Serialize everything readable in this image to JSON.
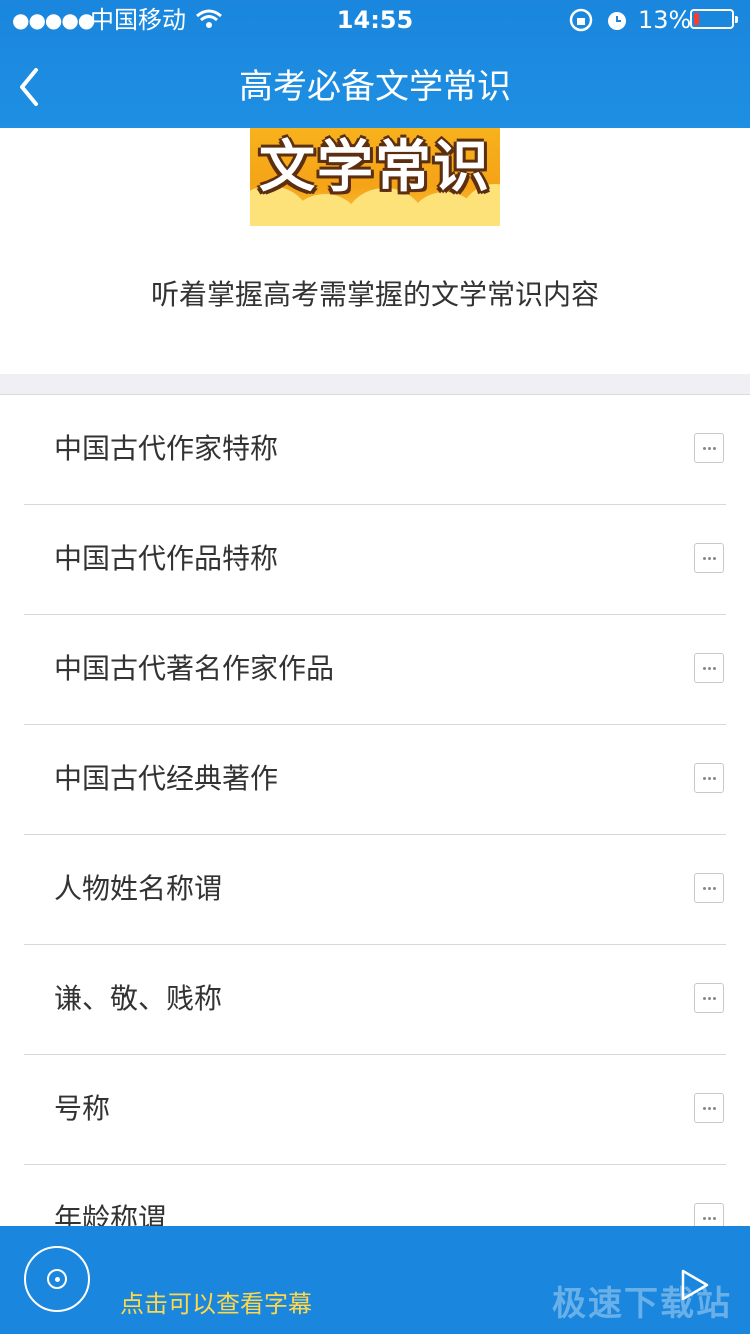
{
  "status_bar": {
    "signal": "●●●●●",
    "carrier": "中国移动",
    "time": "14:55",
    "battery": "13%",
    "battery_level_pct": 13
  },
  "nav": {
    "title": "高考必备文学常识",
    "back_icon": "chevron-left-icon"
  },
  "header": {
    "banner_text": "文学常识",
    "description": "听着掌握高考需掌握的文学常识内容"
  },
  "list": {
    "items": [
      {
        "label": "中国古代作家特称"
      },
      {
        "label": "中国古代作品特称"
      },
      {
        "label": "中国古代著名作家作品"
      },
      {
        "label": "中国古代经典著作"
      },
      {
        "label": "人物姓名称谓"
      },
      {
        "label": "谦、敬、贱称"
      },
      {
        "label": "号称"
      },
      {
        "label": "年龄称谓"
      }
    ],
    "more_icon": "more-dots-icon"
  },
  "player": {
    "subtitle_link": "点击可以查看字幕",
    "watermark": "极速下载站"
  },
  "colors": {
    "brand": "#1a86dd",
    "accent_text": "#ffd84a",
    "battery_low": "#ff3b30"
  }
}
